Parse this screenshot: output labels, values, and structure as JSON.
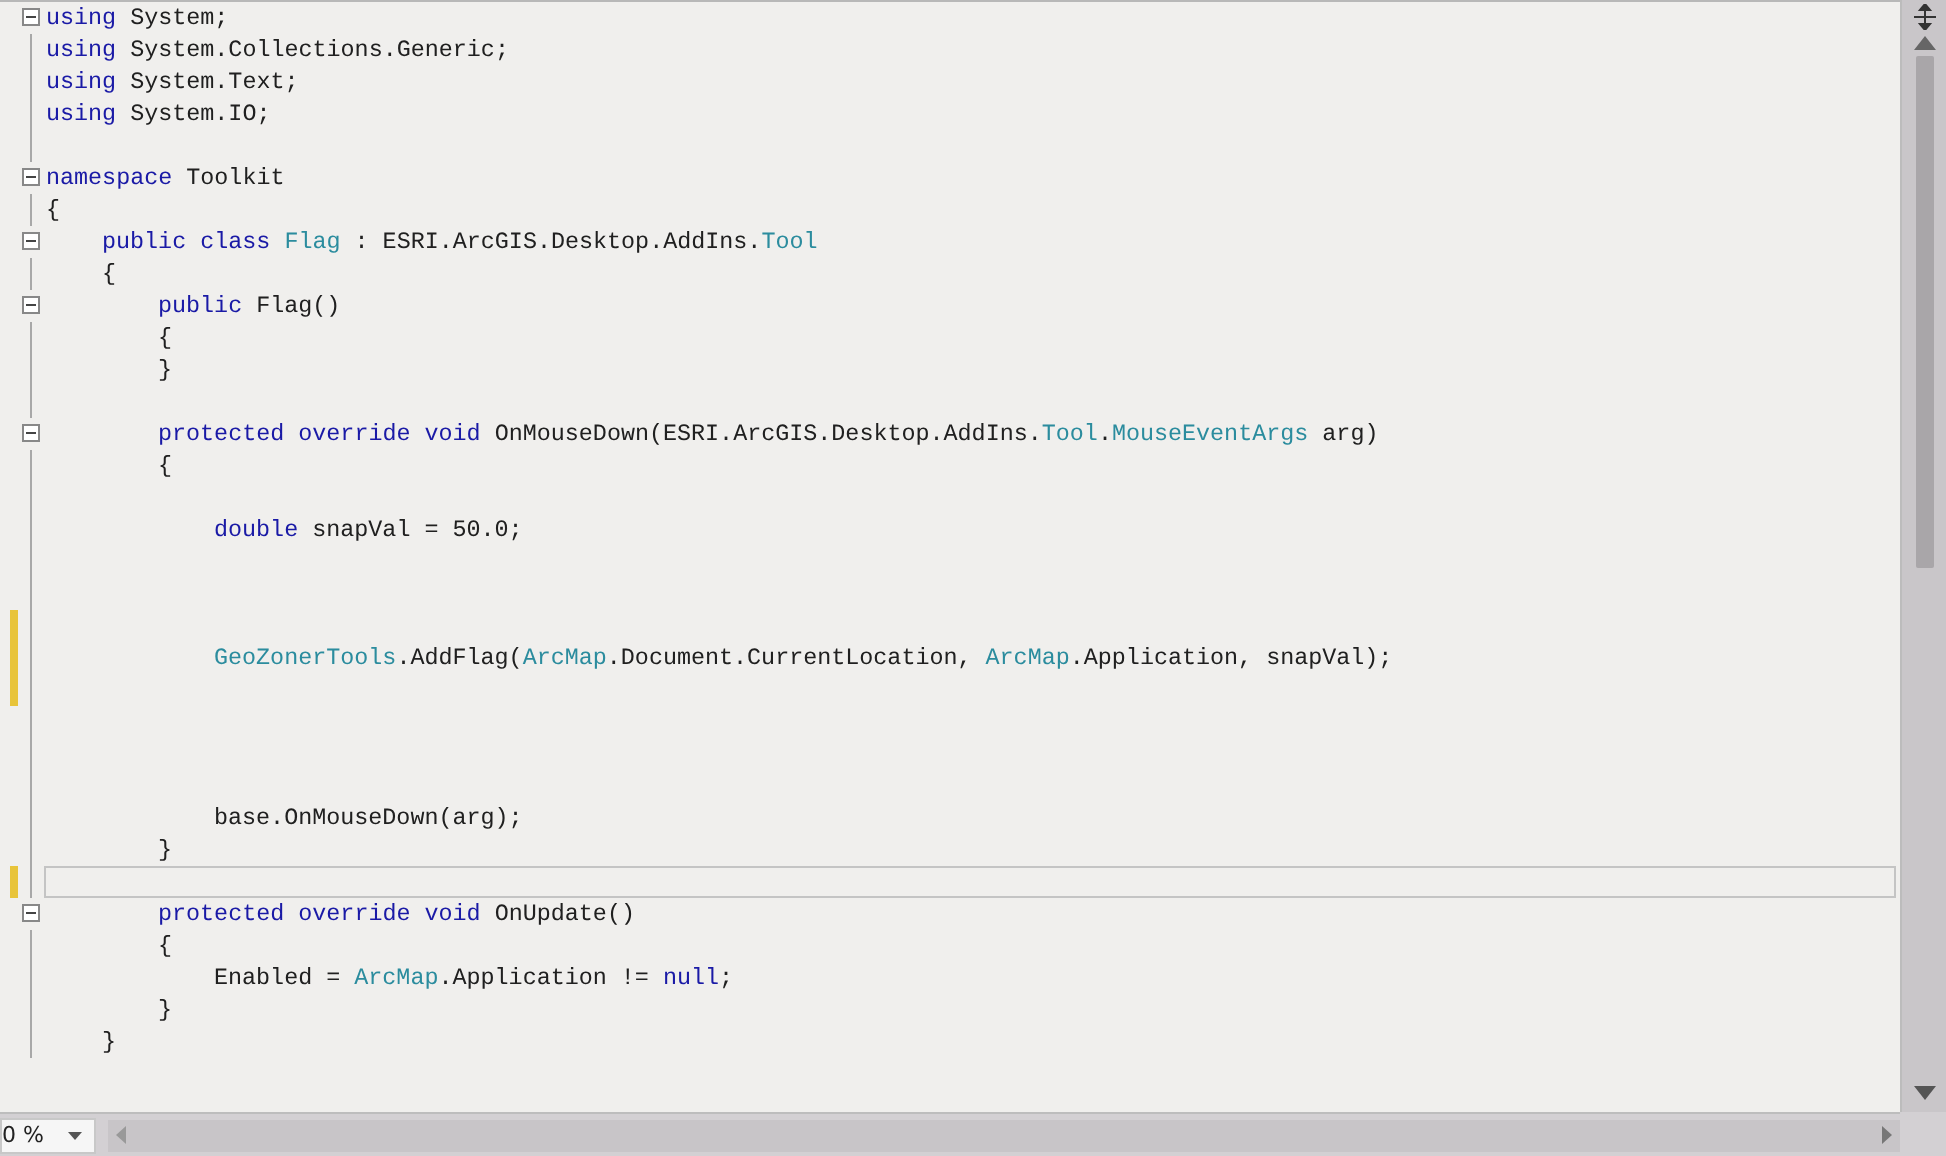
{
  "editor": {
    "lines": [
      {
        "kind": "code",
        "fold": true,
        "changed": false,
        "current": false,
        "tokens": [
          {
            "kind": "keyword",
            "text": "using"
          },
          {
            "kind": "plain",
            "text": " System;"
          }
        ]
      },
      {
        "kind": "code",
        "fold": false,
        "changed": false,
        "current": false,
        "tokens": [
          {
            "kind": "keyword",
            "text": "using"
          },
          {
            "kind": "plain",
            "text": " System.Collections.Generic;"
          }
        ]
      },
      {
        "kind": "code",
        "fold": false,
        "changed": false,
        "current": false,
        "tokens": [
          {
            "kind": "keyword",
            "text": "using"
          },
          {
            "kind": "plain",
            "text": " System.Text;"
          }
        ]
      },
      {
        "kind": "code",
        "fold": false,
        "changed": false,
        "current": false,
        "tokens": [
          {
            "kind": "keyword",
            "text": "using"
          },
          {
            "kind": "plain",
            "text": " System.IO;"
          }
        ]
      },
      {
        "kind": "blank",
        "fold": false,
        "changed": false,
        "current": false
      },
      {
        "kind": "code",
        "fold": true,
        "changed": false,
        "current": false,
        "tokens": [
          {
            "kind": "keyword",
            "text": "namespace"
          },
          {
            "kind": "plain",
            "text": " Toolkit"
          }
        ]
      },
      {
        "kind": "code",
        "fold": false,
        "changed": false,
        "current": false,
        "tokens": [
          {
            "kind": "plain",
            "text": "{"
          }
        ],
        "children": [
          {
            "kind": "code",
            "fold": true,
            "changed": false,
            "current": false,
            "tokens": [
              {
                "kind": "keyword",
                "text": "public"
              },
              {
                "kind": "keyword",
                "text": " class"
              },
              {
                "kind": "type",
                "text": " Flag"
              },
              {
                "kind": "plain",
                "text": " : ESRI.ArcGIS.Desktop.AddIns."
              },
              {
                "kind": "type",
                "text": "Tool"
              }
            ]
          },
          {
            "kind": "code",
            "fold": false,
            "changed": false,
            "current": false,
            "tokens": [
              {
                "kind": "plain",
                "text": "{"
              }
            ],
            "children": [
              {
                "kind": "code",
                "fold": true,
                "changed": false,
                "current": false,
                "tokens": [
                  {
                    "kind": "keyword",
                    "text": "public"
                  },
                  {
                    "kind": "plain",
                    "text": " Flag()"
                  }
                ]
              },
              {
                "kind": "code",
                "fold": false,
                "changed": false,
                "current": false,
                "tokens": [
                  {
                    "kind": "plain",
                    "text": "{"
                  }
                ]
              },
              {
                "kind": "code",
                "fold": false,
                "changed": false,
                "current": false,
                "tokens": [
                  {
                    "kind": "plain",
                    "text": "}"
                  }
                ]
              },
              {
                "kind": "blank",
                "fold": false,
                "changed": false,
                "current": false
              },
              {
                "kind": "code",
                "fold": true,
                "changed": false,
                "current": false,
                "tokens": [
                  {
                    "kind": "keyword",
                    "text": "protected"
                  },
                  {
                    "kind": "keyword",
                    "text": " override"
                  },
                  {
                    "kind": "keyword",
                    "text": " void"
                  },
                  {
                    "kind": "plain",
                    "text": " OnMouseDown(ESRI.ArcGIS.Desktop.AddIns."
                  },
                  {
                    "kind": "type",
                    "text": "Tool"
                  },
                  {
                    "kind": "plain",
                    "text": "."
                  },
                  {
                    "kind": "type",
                    "text": "MouseEventArgs"
                  },
                  {
                    "kind": "plain",
                    "text": " arg)"
                  }
                ]
              },
              {
                "kind": "code",
                "fold": false,
                "changed": false,
                "current": false,
                "tokens": [
                  {
                    "kind": "plain",
                    "text": "{"
                  }
                ],
                "children": [
                  {
                    "kind": "blank",
                    "fold": false,
                    "changed": false,
                    "current": false
                  },
                  {
                    "kind": "code",
                    "fold": false,
                    "changed": false,
                    "current": false,
                    "tokens": [
                      {
                        "kind": "keyword",
                        "text": "double"
                      },
                      {
                        "kind": "plain",
                        "text": " snapVal = 50.0;"
                      }
                    ]
                  },
                  {
                    "kind": "blank",
                    "fold": false,
                    "changed": false,
                    "current": false
                  },
                  {
                    "kind": "blank",
                    "fold": false,
                    "changed": false,
                    "current": false
                  },
                  {
                    "kind": "blank",
                    "fold": false,
                    "changed": true,
                    "current": false
                  },
                  {
                    "kind": "code",
                    "fold": false,
                    "changed": true,
                    "current": false,
                    "tokens": [
                      {
                        "kind": "type",
                        "text": "GeoZonerTools"
                      },
                      {
                        "kind": "plain",
                        "text": ".AddFlag("
                      },
                      {
                        "kind": "type",
                        "text": "ArcMap"
                      },
                      {
                        "kind": "plain",
                        "text": ".Document.CurrentLocation, "
                      },
                      {
                        "kind": "type",
                        "text": "ArcMap"
                      },
                      {
                        "kind": "plain",
                        "text": ".Application, snapVal);"
                      }
                    ]
                  },
                  {
                    "kind": "blank",
                    "fold": false,
                    "changed": true,
                    "current": false
                  },
                  {
                    "kind": "blank",
                    "fold": false,
                    "changed": false,
                    "current": false
                  },
                  {
                    "kind": "blank",
                    "fold": false,
                    "changed": false,
                    "current": false
                  },
                  {
                    "kind": "blank",
                    "fold": false,
                    "changed": false,
                    "current": false
                  },
                  {
                    "kind": "code",
                    "fold": false,
                    "changed": false,
                    "current": false,
                    "tokens": [
                      {
                        "kind": "plain",
                        "text": "base.OnMouseDown(arg);"
                      }
                    ]
                  }
                ]
              },
              {
                "kind": "code",
                "fold": false,
                "changed": false,
                "current": false,
                "tokens": [
                  {
                    "kind": "plain",
                    "text": "}"
                  }
                ]
              },
              {
                "kind": "blank",
                "fold": false,
                "changed": true,
                "current": true
              },
              {
                "kind": "code",
                "fold": true,
                "changed": false,
                "current": false,
                "tokens": [
                  {
                    "kind": "keyword",
                    "text": "protected"
                  },
                  {
                    "kind": "keyword",
                    "text": " override"
                  },
                  {
                    "kind": "keyword",
                    "text": " void"
                  },
                  {
                    "kind": "plain",
                    "text": " OnUpdate()"
                  }
                ]
              },
              {
                "kind": "code",
                "fold": false,
                "changed": false,
                "current": false,
                "tokens": [
                  {
                    "kind": "plain",
                    "text": "{"
                  }
                ],
                "children": [
                  {
                    "kind": "code",
                    "fold": false,
                    "changed": false,
                    "current": false,
                    "tokens": [
                      {
                        "kind": "plain",
                        "text": "Enabled = "
                      },
                      {
                        "kind": "type",
                        "text": "ArcMap"
                      },
                      {
                        "kind": "plain",
                        "text": ".Application != "
                      },
                      {
                        "kind": "keyword",
                        "text": "null"
                      },
                      {
                        "kind": "plain",
                        "text": ";"
                      }
                    ]
                  }
                ]
              },
              {
                "kind": "code",
                "fold": false,
                "changed": false,
                "current": false,
                "tokens": [
                  {
                    "kind": "plain",
                    "text": "}"
                  }
                ]
              }
            ]
          },
          {
            "kind": "code",
            "fold": false,
            "changed": false,
            "current": false,
            "tokens": [
              {
                "kind": "plain",
                "text": "}"
              }
            ]
          }
        ]
      }
    ]
  },
  "zoom": {
    "value": "0 %"
  }
}
